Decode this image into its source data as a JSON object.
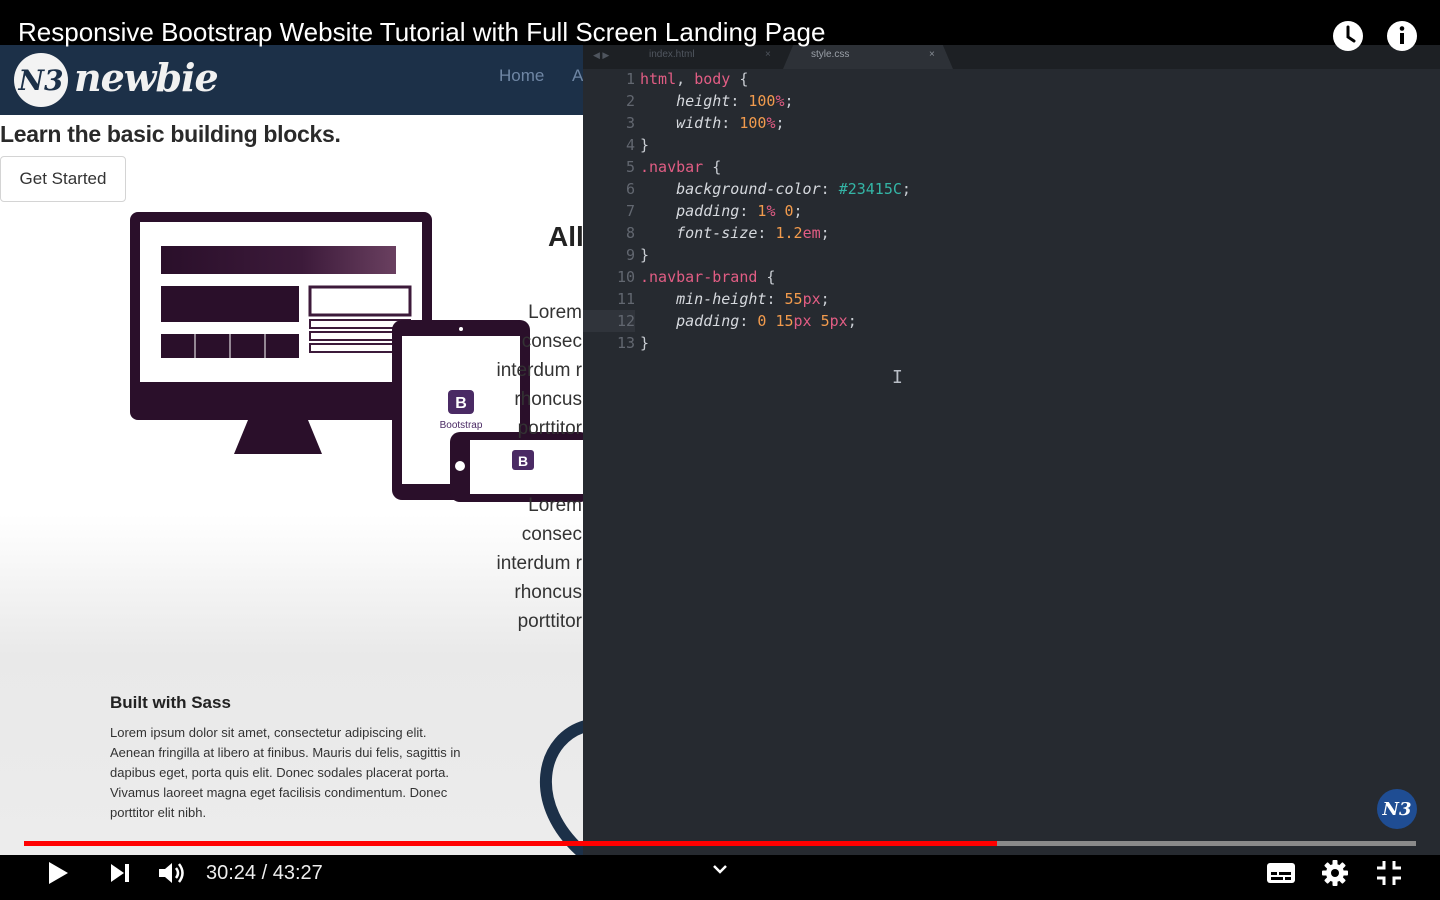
{
  "video": {
    "title": "Responsive Bootstrap Website Tutorial with Full Screen Landing Page",
    "current_time": "30:24",
    "separator": "/",
    "duration": "43:27",
    "progress_fraction": 0.6993
  },
  "site": {
    "logo_mark": "N3",
    "logo_text": "newbie",
    "nav_home": "Home",
    "nav_a": "A",
    "hero_title": "Learn the basic building blocks.",
    "get_started": "Get Started",
    "bootstrap_badge": "B",
    "bootstrap_label": "Bootstrap",
    "column_heading": "All",
    "lorem_a": [
      "Lorem",
      "consec",
      "interdum r",
      "rhoncus",
      "porttitor"
    ],
    "lorem_b": [
      "Lorem",
      "consec",
      "interdum r",
      "rhoncus",
      "porttitor"
    ],
    "sass_title": "Built with Sass",
    "sass_body": "Lorem ipsum dolor sit amet, consectetur adipiscing elit. Aenean fringilla at libero at finibus. Mauris dui felis, sagittis in dapibus eget, porta quis elit. Donec sodales placerat porta. Vivamus laoreet magna eget facilisis condimentum. Donec porttitor elit nibh."
  },
  "editor": {
    "tab_arrows": "◀ ▶",
    "tab_index": "index.html",
    "tab_style": "style.css",
    "tab_close": "×",
    "line_numbers": [
      "1",
      "2",
      "3",
      "4",
      "5",
      "6",
      "7",
      "8",
      "9",
      "10",
      "11",
      "12",
      "13"
    ],
    "code": {
      "l1_sel1": "html",
      "l1_comma": ", ",
      "l1_sel2": "body",
      "l1_brace": " {",
      "l2_prop": "height",
      "l2_num": "100",
      "l2_unit": "%",
      "l3_prop": "width",
      "l3_num": "100",
      "l3_unit": "%",
      "l4": "}",
      "l5_sel": ".navbar",
      "l5_brace": " {",
      "l6_prop": "background-color",
      "l6_hex": "#23415C",
      "l7_prop": "padding",
      "l7_num1": "1",
      "l7_unit1": "%",
      "l7_num2": "0",
      "l8_prop": "font-size",
      "l8_num": "1.2",
      "l8_unit": "em",
      "l9": "}",
      "l10_sel": ".navbar-brand",
      "l10_brace": " {",
      "l11_prop": "min-height",
      "l11_num": "55",
      "l11_unit": "px",
      "l12_prop": "padding",
      "l12_num1": "0",
      "l12_num2": "15",
      "l12_unit2": "px",
      "l12_num3": "5",
      "l12_unit3": "px",
      "l13": "}"
    },
    "text_cursor": "I",
    "watermark": "N3"
  },
  "icons": {
    "watch_later": "clock-icon",
    "info": "info-icon",
    "play": "play-icon",
    "next": "next-icon",
    "volume": "volume-icon",
    "chapters": "chevron-down-icon",
    "captions": "captions-icon",
    "settings": "gear-icon",
    "exit_fullscreen": "exit-fullscreen-icon"
  },
  "colors": {
    "progress": "#ff0000",
    "editor_bg": "#262a30",
    "navbar": "#1c3048",
    "device_purple": "#2a0f2a"
  }
}
